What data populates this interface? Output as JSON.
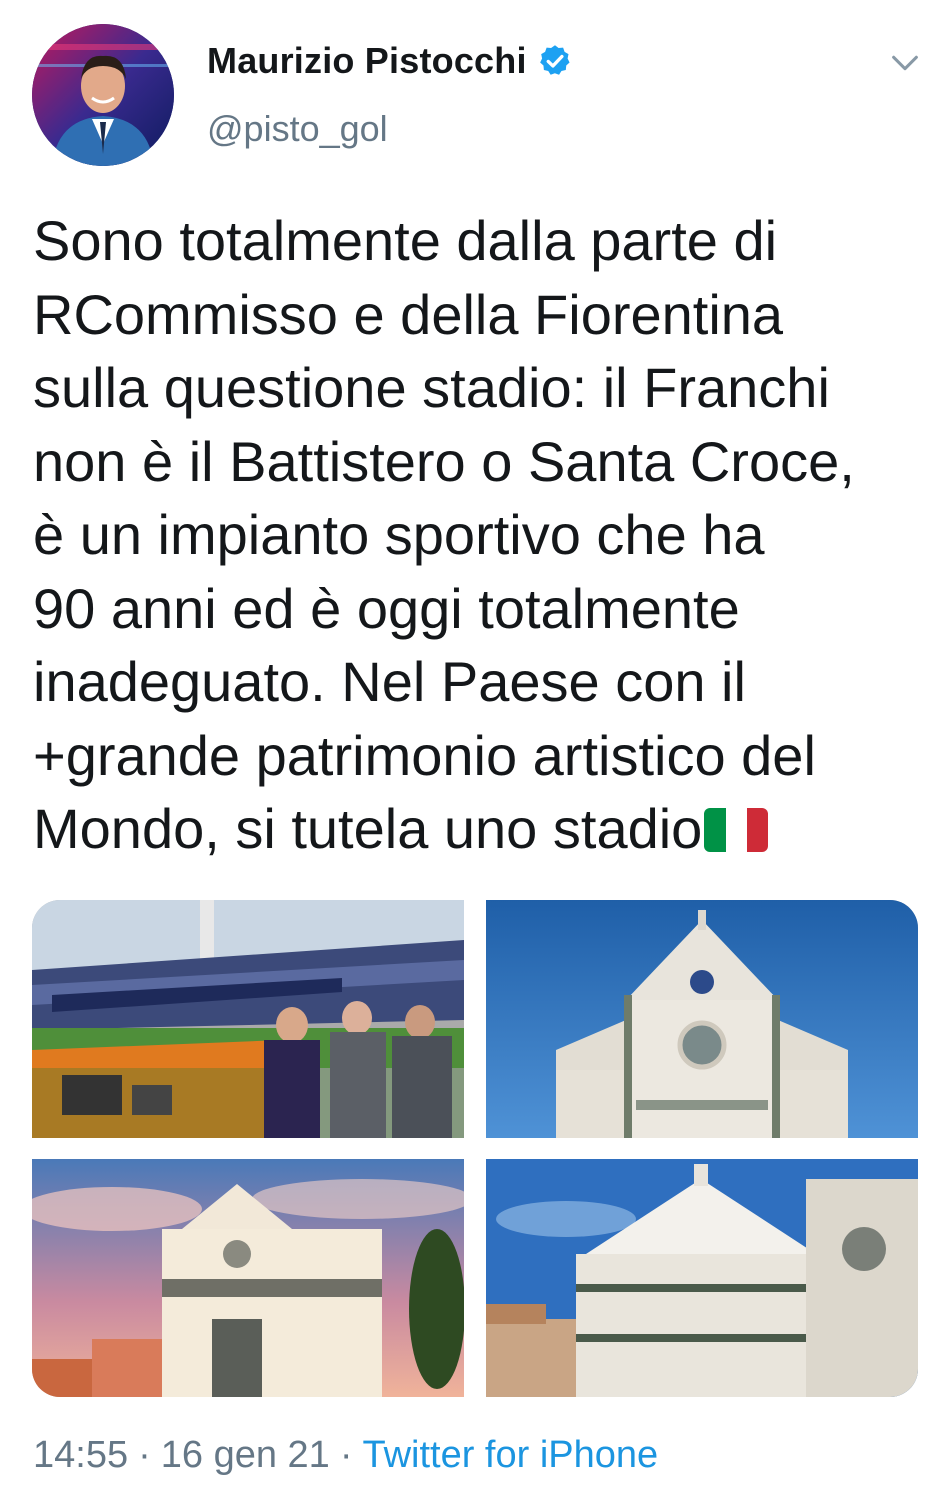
{
  "author": {
    "display_name": "Maurizio Pistocchi",
    "handle": "@pisto_gol",
    "verified": true
  },
  "tweet": {
    "text_lines": [
      "Sono totalmente dalla parte di",
      "RCommisso e della Fiorentina",
      "sulla questione stadio: il Franchi",
      "non è il Battistero o Santa Croce,",
      "è un impianto sportivo che ha",
      "90 anni ed è oggi totalmente",
      "inadeguato. Nel Paese con il",
      "+grande patrimonio artistico del",
      "Mondo, si tutela uno stadio"
    ],
    "emoji": "italy-flag",
    "media": [
      {
        "icon": "stadium-photo"
      },
      {
        "icon": "santa-croce-photo"
      },
      {
        "icon": "santa-maria-novella-photo"
      },
      {
        "icon": "baptistery-photo"
      }
    ]
  },
  "meta": {
    "time": "14:55",
    "date": "16 gen 21",
    "separator": "·",
    "source": "Twitter for iPhone"
  },
  "colors": {
    "text": "#14171a",
    "secondary": "#657786",
    "link": "#1b95e0",
    "verified": "#1da1f2"
  }
}
